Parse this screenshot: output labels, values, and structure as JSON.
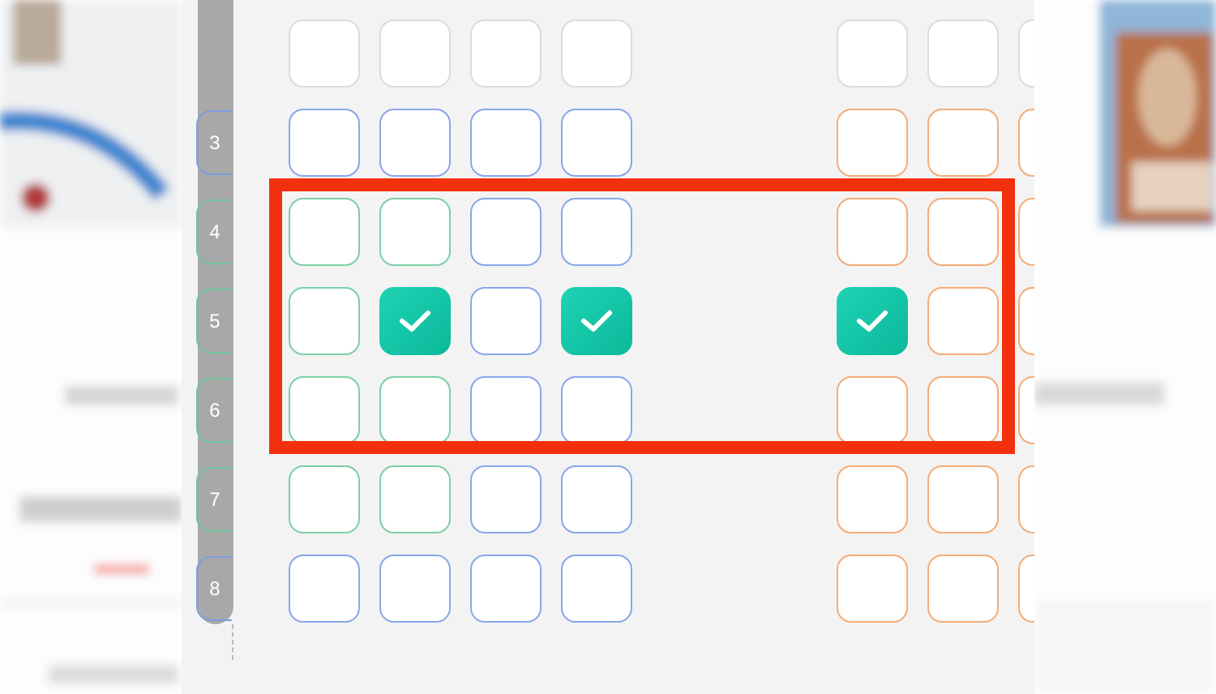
{
  "seat_map": {
    "rows": [
      {
        "seats": [
          {
            "color": "#dcdcdc",
            "selected": false
          },
          {
            "color": "#dcdcdc",
            "selected": false
          },
          {
            "color": "#dcdcdc",
            "selected": false
          },
          {
            "color": "#dcdcdc",
            "selected": false
          },
          {
            "color": "#dcdcdc",
            "selected": false
          },
          {
            "color": "#dcdcdc",
            "selected": false
          },
          {
            "color": "#dcdcdc",
            "selected": false
          }
        ]
      },
      {
        "label": "3",
        "color": "#7f9be0",
        "seats": [
          {
            "color": "#8aa6ea",
            "selected": false
          },
          {
            "color": "#8aa6ea",
            "selected": false
          },
          {
            "color": "#8aa6ea",
            "selected": false
          },
          {
            "color": "#8aa6ea",
            "selected": false
          },
          {
            "color": "#f4ac78",
            "selected": false
          },
          {
            "color": "#f4ac78",
            "selected": false
          },
          {
            "color": "#f4ac78",
            "selected": false
          }
        ]
      },
      {
        "label": "4",
        "color": "#6cc49a",
        "seats": [
          {
            "color": "#7ccfa6",
            "selected": false
          },
          {
            "color": "#7ccfa6",
            "selected": false
          },
          {
            "color": "#8aa6ea",
            "selected": false
          },
          {
            "color": "#8aa6ea",
            "selected": false
          },
          {
            "color": "#f4ac78",
            "selected": false
          },
          {
            "color": "#f4ac78",
            "selected": false
          },
          {
            "color": "#f4ac78",
            "selected": false
          }
        ]
      },
      {
        "label": "5",
        "color": "#6cc49a",
        "seats": [
          {
            "color": "#7ccfa6",
            "selected": false
          },
          {
            "selected": true
          },
          {
            "color": "#8aa6ea",
            "selected": false
          },
          {
            "selected": true
          },
          {
            "selected": true
          },
          {
            "color": "#f4ac78",
            "selected": false
          },
          {
            "color": "#f4ac78",
            "selected": false
          }
        ]
      },
      {
        "label": "6",
        "color": "#6cc49a",
        "seats": [
          {
            "color": "#7ccfa6",
            "selected": false
          },
          {
            "color": "#7ccfa6",
            "selected": false
          },
          {
            "color": "#8aa6ea",
            "selected": false
          },
          {
            "color": "#8aa6ea",
            "selected": false
          },
          {
            "color": "#f4ac78",
            "selected": false
          },
          {
            "color": "#f4ac78",
            "selected": false
          },
          {
            "color": "#f4ac78",
            "selected": false
          }
        ]
      },
      {
        "label": "7",
        "color": "#6cc49a",
        "seats": [
          {
            "color": "#7ccfa6",
            "selected": false
          },
          {
            "color": "#7ccfa6",
            "selected": false
          },
          {
            "color": "#8aa6ea",
            "selected": false
          },
          {
            "color": "#8aa6ea",
            "selected": false
          },
          {
            "color": "#f4ac78",
            "selected": false
          },
          {
            "color": "#f4ac78",
            "selected": false
          },
          {
            "color": "#f4ac78",
            "selected": false
          }
        ]
      },
      {
        "label": "8",
        "color": "#7f9be0",
        "seats": [
          {
            "color": "#8aa6ea",
            "selected": false
          },
          {
            "color": "#8aa6ea",
            "selected": false
          },
          {
            "color": "#8aa6ea",
            "selected": false
          },
          {
            "color": "#8aa6ea",
            "selected": false
          },
          {
            "color": "#f4ac78",
            "selected": false
          },
          {
            "color": "#f4ac78",
            "selected": false
          },
          {
            "color": "#f4ac78",
            "selected": false
          }
        ]
      }
    ]
  }
}
